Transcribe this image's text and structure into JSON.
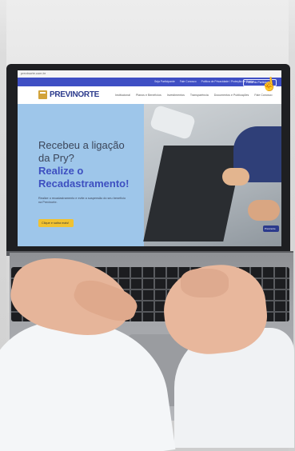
{
  "screen": {
    "url": "previnorte.com.br",
    "top_nav": {
      "items": [
        "Seja Participante",
        "Fale Conosco",
        "Política de Privacidade / Proteção de Dados",
        "Portal do Participante"
      ],
      "portal_button": "Portal do Participante"
    },
    "logo_text": "PREVINORTE",
    "main_nav": [
      "Institucional",
      "Planos e Benefícios",
      "Investimentos",
      "Transparência",
      "Documentos e Publicações",
      "Fale Conosco"
    ],
    "hero": {
      "line1": "Recebeu a ligação",
      "line2": "da Pry?",
      "line3": "Realize o",
      "line4": "Recadastramento!",
      "sub": "Realize o recadastramento e evite a suspensão do seu benefício na Previnorte.",
      "cta": "Clique e saiba mais!",
      "badge": "Previnorte"
    }
  },
  "colors": {
    "top_nav": "#3f4fc4",
    "hero_bg": "#9ec6ea",
    "headline_accent": "#3d4fc0",
    "cta": "#f1c230",
    "logo": "#2b3a8c"
  },
  "icons": [
    "pointer-hand-cursor-icon",
    "logo-mark-icon"
  ]
}
